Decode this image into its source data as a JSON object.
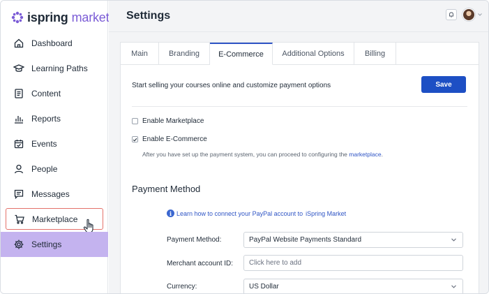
{
  "app": {
    "logo_text_a": "ispring",
    "logo_text_b": "market",
    "brand_color": "#7b5cd6"
  },
  "sidebar": {
    "items": [
      {
        "label": "Dashboard",
        "icon": "home-icon"
      },
      {
        "label": "Learning Paths",
        "icon": "graduation-cap-icon"
      },
      {
        "label": "Content",
        "icon": "document-icon"
      },
      {
        "label": "Reports",
        "icon": "bar-chart-icon"
      },
      {
        "label": "Events",
        "icon": "calendar-check-icon"
      },
      {
        "label": "People",
        "icon": "person-icon"
      },
      {
        "label": "Messages",
        "icon": "message-icon"
      },
      {
        "label": "Marketplace",
        "icon": "cart-icon"
      },
      {
        "label": "Settings",
        "icon": "gear-icon"
      }
    ],
    "active_color": "#c4b3ef",
    "highlight_color": "#e4716a"
  },
  "header": {
    "title": "Settings"
  },
  "tabs": [
    {
      "label": "Main"
    },
    {
      "label": "Branding"
    },
    {
      "label": "E-Commerce"
    },
    {
      "label": "Additional Options"
    },
    {
      "label": "Billing"
    }
  ],
  "ecommerce": {
    "intro": "Start selling your courses online and customize payment options",
    "save_label": "Save",
    "enable_marketplace_label": "Enable Marketplace",
    "enable_marketplace_checked": false,
    "enable_ecommerce_label": "Enable E-Commerce",
    "enable_ecommerce_checked": true,
    "help_text_prefix": "After you have set up the payment system, you can proceed to configuring the ",
    "help_link": "marketplace",
    "help_text_suffix": ".",
    "section_title": "Payment Method",
    "info_link_a": "Learn how to connect your PayPal account to",
    "info_link_b": "iSpring Market",
    "payment_method_label": "Payment Method:",
    "payment_method_value": "PayPal Website Payments Standard",
    "merchant_label": "Merchant account ID:",
    "merchant_placeholder": "Click here to add",
    "currency_label": "Currency:",
    "currency_value": "US Dollar",
    "accent_color": "#1d4fc4"
  }
}
